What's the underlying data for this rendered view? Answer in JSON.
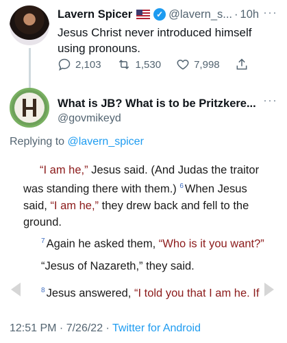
{
  "tweet1": {
    "name": "Lavern Spicer",
    "handle": "@lavern_s...",
    "separator": "·",
    "time": "10h",
    "more": "···",
    "text": "Jesus Christ never introduced himself using pronouns.",
    "replies": "2,103",
    "retweets": "1,530",
    "likes": "7,998"
  },
  "tweet2": {
    "name": "What is JB? What is to be Pritzkere...",
    "handle": "@govmikeyd",
    "more": "···",
    "replying_prefix": "Replying to ",
    "replying_to": "@lavern_spicer",
    "passage": {
      "p1_quote1": "“I am he,”",
      "p1_text1": " Jesus said. (And Judas the traitor was standing there with them.) ",
      "v6": "6",
      "p1_text2": "When Jesus said, ",
      "p1_quote2": "“I am he,”",
      "p1_text3": " they drew back and fell to the ground.",
      "v7": "7",
      "p2_text": "Again he asked them, ",
      "p2_quote": "“Who is it you want?”",
      "p3_text": "“Jesus of Nazareth,” they said.",
      "v8": "8",
      "p4_text": "Jesus answered, ",
      "p4_quote": "“I told you that I am he. If"
    },
    "footer_time": "12:51 PM",
    "footer_sep1": " · ",
    "footer_date": "7/26/22",
    "footer_sep2": " · ",
    "footer_source": "Twitter for Android"
  },
  "colors": {
    "accent": "#1d9bf0",
    "verse_red": "#8b1a1a",
    "muted": "#536471"
  },
  "icons": {
    "reply": "reply-icon",
    "retweet": "retweet-icon",
    "like": "heart-icon",
    "share": "share-icon",
    "verified": "verified-badge-icon",
    "flag": "us-flag-icon"
  }
}
